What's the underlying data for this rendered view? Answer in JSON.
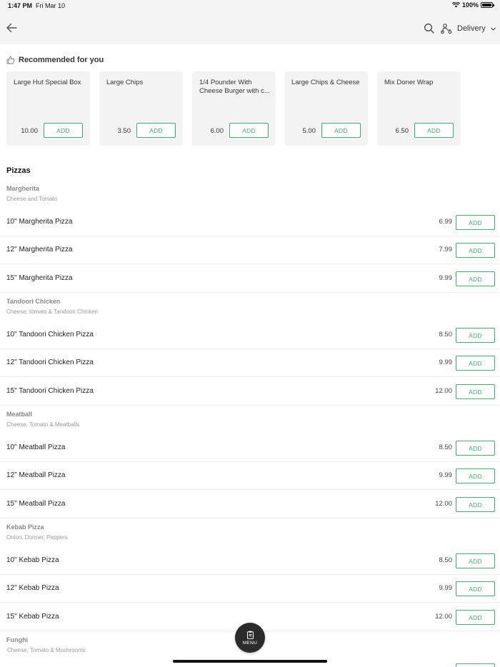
{
  "status_bar": {
    "time": "1:47 PM",
    "date": "Fri Mar 10",
    "battery": "100%"
  },
  "header": {
    "delivery_label": "Delivery"
  },
  "icons": {
    "back": "arrow-left-icon",
    "search": "search-icon",
    "delivery": "scooter-icon",
    "chevron": "chevron-down-icon",
    "recommended": "thumbs-up-icon",
    "menu": "clipboard-icon"
  },
  "colors": {
    "accent": "#3fae6a",
    "nav_bg": "#f4f4f4",
    "card_bg": "#f3f3f3",
    "fab_bg": "#2b2b2b"
  },
  "recommended": {
    "title": "Recommended for you",
    "items": [
      {
        "name": "Large Hut Special Box",
        "price": "10.00",
        "add_label": "ADD"
      },
      {
        "name": "Large Chips",
        "price": "3.50",
        "add_label": "ADD"
      },
      {
        "name": "1/4 Pounder With Cheese Burger with c...",
        "price": "6.00",
        "add_label": "ADD"
      },
      {
        "name": "Large Chips & Cheese",
        "price": "5.00",
        "add_label": "ADD"
      },
      {
        "name": "Mix Doner Wrap",
        "price": "6.50",
        "add_label": "ADD"
      }
    ]
  },
  "menu_section": {
    "title": "Pizzas",
    "groups": [
      {
        "name": "Margherita",
        "description": "Cheese and Tomato",
        "items": [
          {
            "name": "10\" Margherita Pizza",
            "price": "6.99",
            "add_label": "ADD"
          },
          {
            "name": "12\" Margherita Pizza",
            "price": "7.99",
            "add_label": "ADD"
          },
          {
            "name": "15\" Margherita Pizza",
            "price": "9.99",
            "add_label": "ADD"
          }
        ]
      },
      {
        "name": "Tandoori Chicken",
        "description": "Cheese, tomato & Tandoori Chicken",
        "items": [
          {
            "name": "10\" Tandoori Chicken Pizza",
            "price": "8.50",
            "add_label": "ADD"
          },
          {
            "name": "12\" Tandoori Chicken Pizza",
            "price": "9.99",
            "add_label": "ADD"
          },
          {
            "name": "15\" Tandoori Chicken Pizza",
            "price": "12.00",
            "add_label": "ADD"
          }
        ]
      },
      {
        "name": "Meatball",
        "description": "Cheese, Tomato & Meatballs",
        "items": [
          {
            "name": "10\" Meatball Pizza",
            "price": "8.50",
            "add_label": "ADD"
          },
          {
            "name": "12\" Meatball Pizza",
            "price": "9.99",
            "add_label": "ADD"
          },
          {
            "name": "15\" Meatball Pizza",
            "price": "12.00",
            "add_label": "ADD"
          }
        ]
      },
      {
        "name": "Kebab Pizza",
        "description": "Onion, Donner, Peppers",
        "items": [
          {
            "name": "10\" Kebab Pizza",
            "price": "8.50",
            "add_label": "ADD"
          },
          {
            "name": "12\" Kebab Pizza",
            "price": "9.99",
            "add_label": "ADD"
          },
          {
            "name": "15\" Kebab Pizza",
            "price": "12.00",
            "add_label": "ADD"
          }
        ]
      },
      {
        "name": "Funghi",
        "description": "Cheese, Tomato & Mushrooms",
        "items": []
      }
    ]
  },
  "fab": {
    "label": "MENU"
  }
}
